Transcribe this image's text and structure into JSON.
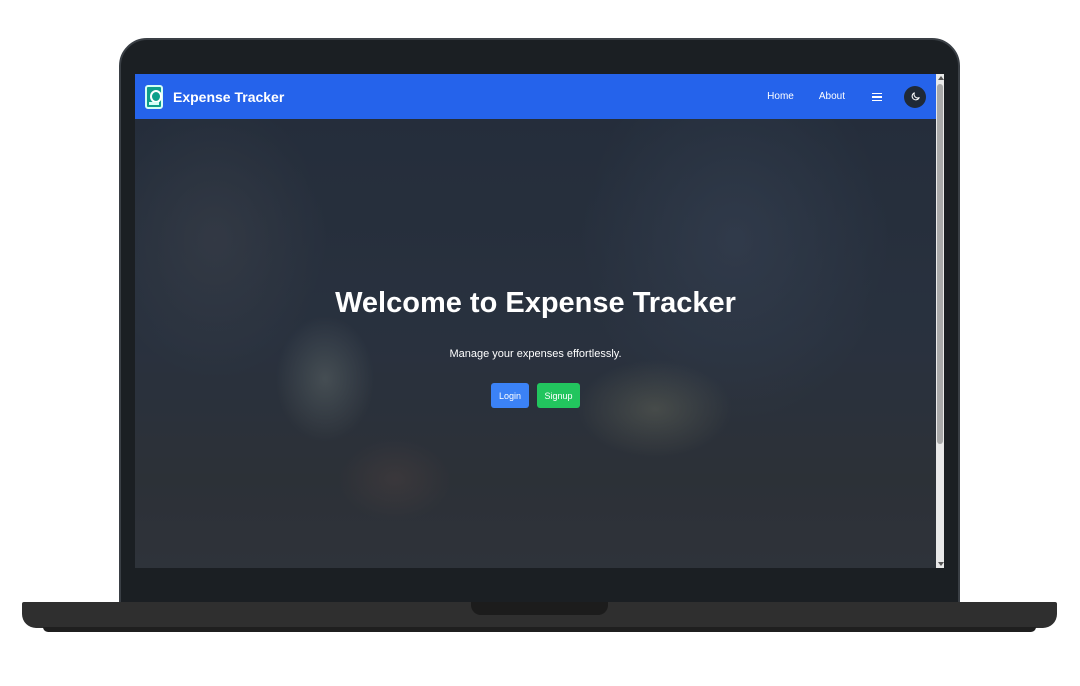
{
  "navbar": {
    "brand_title": "Expense Tracker",
    "links": [
      "Home",
      "About"
    ],
    "color": "#2563eb"
  },
  "hero": {
    "title": "Welcome to Expense Tracker",
    "subtitle": "Manage your expenses effortlessly.",
    "login_label": "Login",
    "signup_label": "Signup"
  },
  "icons": {
    "brand": "expense-app-icon",
    "menu": "hamburger-menu-icon",
    "theme": "moon-icon"
  },
  "colors": {
    "login_button": "#3b82f6",
    "signup_button": "#22c55e"
  }
}
